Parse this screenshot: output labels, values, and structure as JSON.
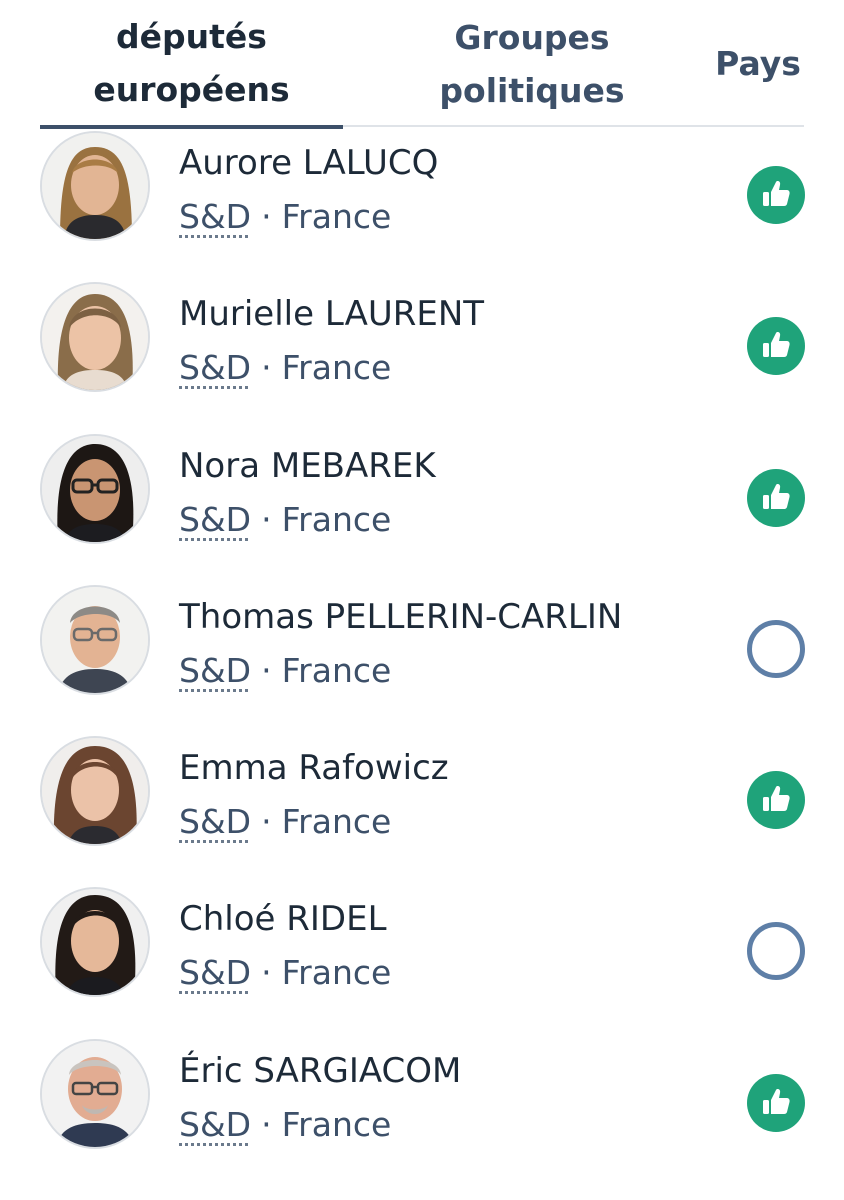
{
  "tabs": [
    {
      "line1": "députés",
      "line2": "européens",
      "active": true
    },
    {
      "line1": "Groupes",
      "line2": "politiques",
      "active": false
    },
    {
      "line1": "Pays",
      "line2": "",
      "active": false
    }
  ],
  "colors": {
    "vote_for": "#1fa37a",
    "no_vote": "#5e7fa7",
    "text_primary": "#1d2a38",
    "text_secondary": "#3d5069"
  },
  "members": [
    {
      "name": "Aurore LALUCQ",
      "group": "S&D",
      "separator": "·",
      "country": "France",
      "vote": "for",
      "vote_icon": "thumbs-up-icon"
    },
    {
      "name": "Murielle LAURENT",
      "group": "S&D",
      "separator": "·",
      "country": "France",
      "vote": "for",
      "vote_icon": "thumbs-up-icon"
    },
    {
      "name": "Nora MEBAREK",
      "group": "S&D",
      "separator": "·",
      "country": "France",
      "vote": "for",
      "vote_icon": "thumbs-up-icon"
    },
    {
      "name": "Thomas PELLERIN-CARLIN",
      "group": "S&D",
      "separator": "·",
      "country": "France",
      "vote": "none",
      "vote_icon": "empty-circle-icon"
    },
    {
      "name": "Emma Rafowicz",
      "group": "S&D",
      "separator": "·",
      "country": "France",
      "vote": "for",
      "vote_icon": "thumbs-up-icon"
    },
    {
      "name": "Chloé RIDEL",
      "group": "S&D",
      "separator": "·",
      "country": "France",
      "vote": "none",
      "vote_icon": "empty-circle-icon"
    },
    {
      "name": "Éric SARGIACOM",
      "group": "S&D",
      "separator": "·",
      "country": "France",
      "vote": "for",
      "vote_icon": "thumbs-up-icon"
    }
  ]
}
